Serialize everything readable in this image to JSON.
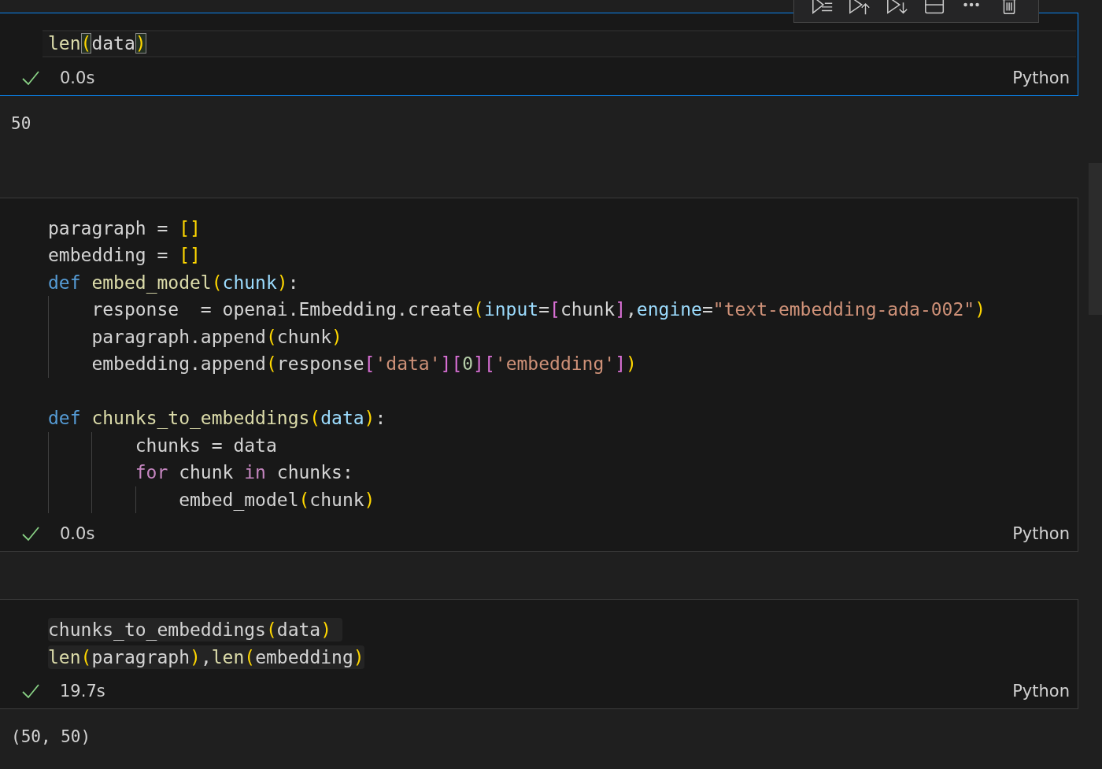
{
  "toolbar": {
    "buttons": [
      {
        "kind": "run-lines"
      },
      {
        "kind": "run-above"
      },
      {
        "kind": "run-below"
      },
      {
        "kind": "split"
      },
      {
        "kind": "more"
      },
      {
        "kind": "delete"
      }
    ]
  },
  "cells": [
    {
      "selected": true,
      "highlighted": false,
      "blocks": [
        {
          "lines": [
            {
              "tokens": [
                {
                  "text": "len",
                  "kind": "func"
                },
                {
                  "text": "(",
                  "kind": "bracket-match"
                },
                {
                  "text": "data",
                  "kind": "plain"
                },
                {
                  "text": ")",
                  "kind": "bracket-match"
                }
              ]
            }
          ]
        }
      ],
      "status": {
        "success": true,
        "time": "0.0s",
        "language": "Python"
      },
      "output": "50"
    },
    {
      "selected": false,
      "highlighted": false,
      "blocks": [
        {
          "lines": [
            {
              "tokens": [
                {
                  "text": "paragraph = ",
                  "kind": "plain"
                },
                {
                  "text": "[]",
                  "kind": "bracket1"
                }
              ]
            },
            {
              "tokens": [
                {
                  "text": "embedding = ",
                  "kind": "plain"
                },
                {
                  "text": "[]",
                  "kind": "bracket1"
                }
              ]
            },
            {
              "tokens": [
                {
                  "text": "def ",
                  "kind": "keyword"
                },
                {
                  "text": "embed_model",
                  "kind": "func"
                },
                {
                  "text": "(",
                  "kind": "bracket1"
                },
                {
                  "text": "chunk",
                  "kind": "param"
                },
                {
                  "text": ")",
                  "kind": "bracket1"
                },
                {
                  "text": ":",
                  "kind": "plain"
                }
              ]
            },
            {
              "tokens": [
                {
                  "text": "    response  = openai.Embedding.create",
                  "kind": "plain"
                },
                {
                  "text": "(",
                  "kind": "bracket1"
                },
                {
                  "text": "input",
                  "kind": "param"
                },
                {
                  "text": "=",
                  "kind": "plain"
                },
                {
                  "text": "[",
                  "kind": "bracket2"
                },
                {
                  "text": "chunk",
                  "kind": "plain"
                },
                {
                  "text": "]",
                  "kind": "bracket2"
                },
                {
                  "text": ",",
                  "kind": "plain"
                },
                {
                  "text": "engine",
                  "kind": "param"
                },
                {
                  "text": "=",
                  "kind": "plain"
                },
                {
                  "text": "\"text-embedding-ada-002\"",
                  "kind": "string"
                },
                {
                  "text": ")",
                  "kind": "bracket1"
                }
              ]
            },
            {
              "tokens": [
                {
                  "text": "    paragraph.append",
                  "kind": "plain"
                },
                {
                  "text": "(",
                  "kind": "bracket1"
                },
                {
                  "text": "chunk",
                  "kind": "plain"
                },
                {
                  "text": ")",
                  "kind": "bracket1"
                }
              ]
            },
            {
              "tokens": [
                {
                  "text": "    embedding.append",
                  "kind": "plain"
                },
                {
                  "text": "(",
                  "kind": "bracket1"
                },
                {
                  "text": "response",
                  "kind": "plain"
                },
                {
                  "text": "[",
                  "kind": "bracket2"
                },
                {
                  "text": "'data'",
                  "kind": "string"
                },
                {
                  "text": "][",
                  "kind": "bracket2"
                },
                {
                  "text": "0",
                  "kind": "number"
                },
                {
                  "text": "][",
                  "kind": "bracket2"
                },
                {
                  "text": "'embedding'",
                  "kind": "string"
                },
                {
                  "text": "]",
                  "kind": "bracket2"
                },
                {
                  "text": ")",
                  "kind": "bracket1"
                }
              ]
            }
          ]
        },
        {
          "lines": [
            {
              "tokens": [
                {
                  "text": "def ",
                  "kind": "keyword"
                },
                {
                  "text": "chunks_to_embeddings",
                  "kind": "func"
                },
                {
                  "text": "(",
                  "kind": "bracket1"
                },
                {
                  "text": "data",
                  "kind": "param"
                },
                {
                  "text": ")",
                  "kind": "bracket1"
                },
                {
                  "text": ":",
                  "kind": "plain"
                }
              ]
            },
            {
              "tokens": [
                {
                  "text": "        chunks = data",
                  "kind": "plain"
                }
              ]
            },
            {
              "tokens": [
                {
                  "text": "        for",
                  "kind": "control"
                },
                {
                  "text": " chunk ",
                  "kind": "plain"
                },
                {
                  "text": "in",
                  "kind": "control"
                },
                {
                  "text": " chunks:",
                  "kind": "plain"
                }
              ]
            },
            {
              "tokens": [
                {
                  "text": "            embed_model",
                  "kind": "plain"
                },
                {
                  "text": "(",
                  "kind": "bracket1"
                },
                {
                  "text": "chunk",
                  "kind": "plain"
                },
                {
                  "text": ")",
                  "kind": "bracket1"
                }
              ]
            }
          ]
        }
      ],
      "status": {
        "success": true,
        "time": "0.0s",
        "language": "Python"
      }
    },
    {
      "selected": false,
      "highlighted": true,
      "blocks": [
        {
          "lines": [
            {
              "tokens": [
                {
                  "text": "chunks_to_embeddings",
                  "kind": "plain"
                },
                {
                  "text": "(",
                  "kind": "bracket1"
                },
                {
                  "text": "data",
                  "kind": "plain"
                },
                {
                  "text": ") ",
                  "kind": "bracket1"
                }
              ]
            },
            {
              "tokens": [
                {
                  "text": "len",
                  "kind": "func"
                },
                {
                  "text": "(",
                  "kind": "bracket1"
                },
                {
                  "text": "paragraph",
                  "kind": "plain"
                },
                {
                  "text": ")",
                  "kind": "bracket1"
                },
                {
                  "text": ",",
                  "kind": "plain"
                },
                {
                  "text": "len",
                  "kind": "func"
                },
                {
                  "text": "(",
                  "kind": "bracket1"
                },
                {
                  "text": "embedding",
                  "kind": "plain"
                },
                {
                  "text": ")",
                  "kind": "bracket1"
                }
              ]
            }
          ]
        }
      ],
      "status": {
        "success": true,
        "time": "19.7s",
        "language": "Python"
      },
      "output": "(50, 50)"
    }
  ]
}
